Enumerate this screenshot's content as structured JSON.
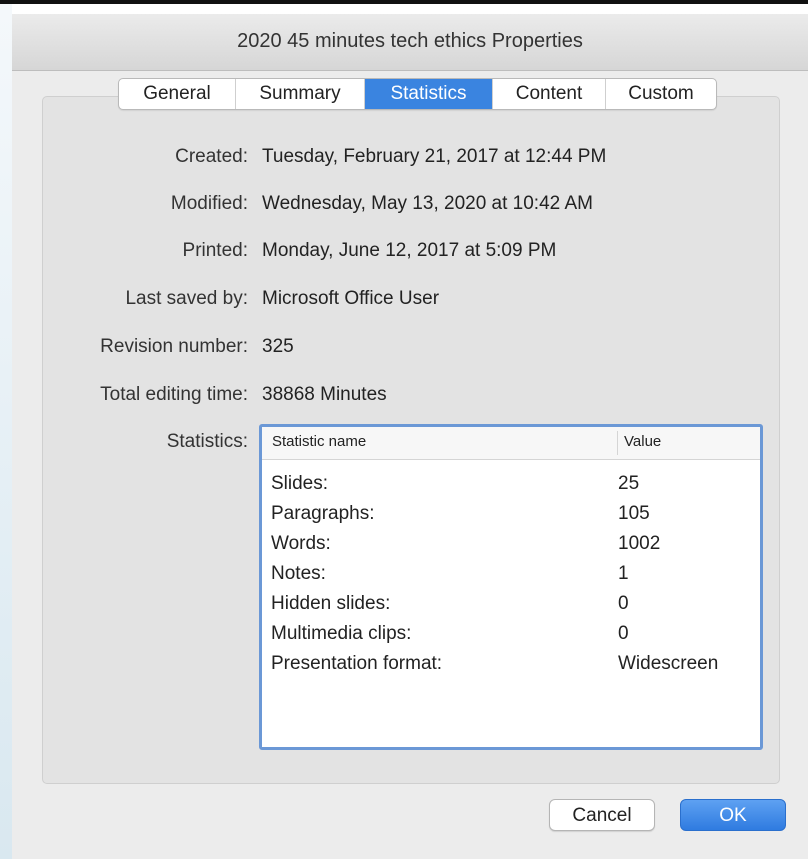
{
  "window": {
    "title": "2020 45 minutes tech ethics Properties"
  },
  "tabs": [
    {
      "label": "General"
    },
    {
      "label": "Summary"
    },
    {
      "label": "Statistics",
      "active": true
    },
    {
      "label": "Content"
    },
    {
      "label": "Custom"
    }
  ],
  "fields": {
    "created": {
      "label": "Created:",
      "value": "Tuesday, February 21, 2017 at 12:44 PM"
    },
    "modified": {
      "label": "Modified:",
      "value": "Wednesday, May 13, 2020 at 10:42 AM"
    },
    "printed": {
      "label": "Printed:",
      "value": "Monday, June 12, 2017 at 5:09 PM"
    },
    "last_saved_by": {
      "label": "Last saved by:",
      "value": "Microsoft Office User"
    },
    "revision_number": {
      "label": "Revision number:",
      "value": "325"
    },
    "total_editing_time": {
      "label": "Total editing time:",
      "value": "38868 Minutes"
    }
  },
  "statistics": {
    "label": "Statistics:",
    "headers": {
      "name": "Statistic name",
      "value": "Value"
    },
    "rows": [
      {
        "name": "Slides:",
        "value": "25"
      },
      {
        "name": "Paragraphs:",
        "value": "105"
      },
      {
        "name": "Words:",
        "value": "1002"
      },
      {
        "name": "Notes:",
        "value": "1"
      },
      {
        "name": "Hidden slides:",
        "value": "0"
      },
      {
        "name": "Multimedia clips:",
        "value": "0"
      },
      {
        "name": "Presentation format:",
        "value": "Widescreen"
      }
    ]
  },
  "buttons": {
    "cancel": "Cancel",
    "ok": "OK"
  },
  "colors": {
    "accent": "#3a84e0",
    "table_border": "#6b98d6"
  }
}
